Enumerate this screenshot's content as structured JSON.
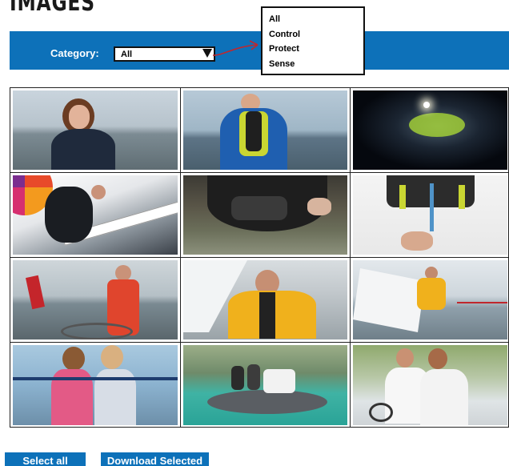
{
  "page": {
    "heading": "IMAGES"
  },
  "filter": {
    "label": "Category:",
    "selected": "All",
    "options": [
      "All",
      "Control",
      "Protect",
      "Sense"
    ]
  },
  "gallery": {
    "thumbnails": [
      {
        "name": "woman-smiling-at-sea-photo"
      },
      {
        "name": "person-wearing-lifejacket-photo"
      },
      {
        "name": "lifejacket-light-at-night-photo"
      },
      {
        "name": "sailor-on-racing-yacht-photo"
      },
      {
        "name": "waist-belt-pack-photo"
      },
      {
        "name": "lifejacket-harness-detail-photo"
      },
      {
        "name": "sailor-at-helm-photo"
      },
      {
        "name": "sailor-in-yellow-jacket-photo"
      },
      {
        "name": "crew-handling-sail-photo"
      },
      {
        "name": "two-girls-in-lifejackets-photo"
      },
      {
        "name": "group-in-rib-boat-photo"
      },
      {
        "name": "friends-driving-boat-photo"
      }
    ]
  },
  "actions": {
    "select_all": "Select all",
    "download_selected": "Download Selected"
  },
  "colors": {
    "brand_blue": "#0d71b9",
    "annotation_red": "#c0272d"
  }
}
